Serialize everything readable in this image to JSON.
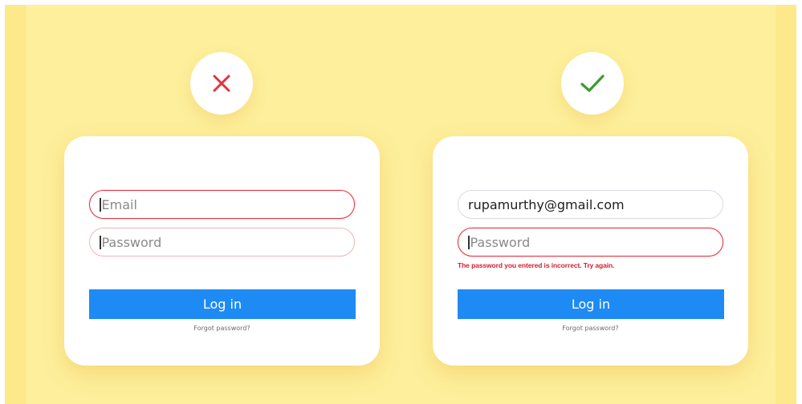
{
  "colors": {
    "background": "#fdef9b",
    "card": "#ffffff",
    "button": "#1e8af3",
    "error": "#e4323f",
    "success": "#3d9b2f"
  },
  "wrong_example": {
    "badge_icon": "cross-icon",
    "email_placeholder": "Email",
    "password_placeholder": "Password",
    "login_label": "Log in",
    "forgot_label": "Forgot password?"
  },
  "right_example": {
    "badge_icon": "check-icon",
    "email_value": "rupamurthy@gmail.com",
    "password_placeholder": "Password",
    "error_message": "The password you entered is incorrect. Try again.",
    "login_label": "Log in",
    "forgot_label": "Forgot password?"
  }
}
